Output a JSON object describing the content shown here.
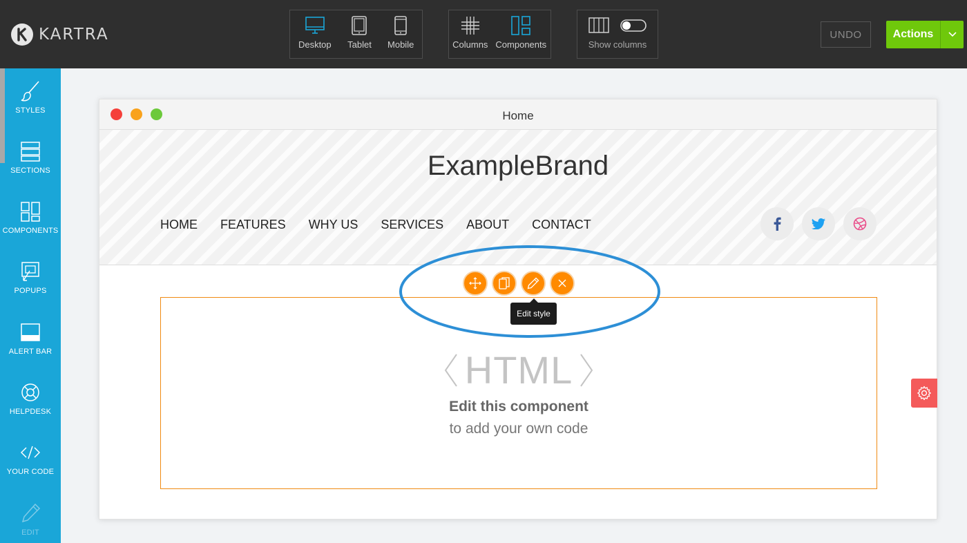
{
  "app": {
    "logo_text": "KARTRA"
  },
  "toolbar": {
    "devices": [
      {
        "label": "Desktop",
        "icon": "desktop-icon",
        "active": true
      },
      {
        "label": "Tablet",
        "icon": "tablet-icon",
        "active": false
      },
      {
        "label": "Mobile",
        "icon": "mobile-icon",
        "active": false
      }
    ],
    "layout": [
      {
        "label": "Columns",
        "icon": "grid-icon"
      },
      {
        "label": "Components",
        "icon": "components-icon"
      }
    ],
    "show_columns_label": "Show columns",
    "show_columns_on": false,
    "undo_label": "UNDO",
    "actions_label": "Actions"
  },
  "sidebar": {
    "items": [
      {
        "label": "STYLES",
        "icon": "brush-icon"
      },
      {
        "label": "SECTIONS",
        "icon": "sections-icon"
      },
      {
        "label": "COMPONENTS",
        "icon": "components-icon"
      },
      {
        "label": "POPUPS",
        "icon": "popup-icon"
      },
      {
        "label": "ALERT BAR",
        "icon": "alert-bar-icon"
      },
      {
        "label": "HELPDESK",
        "icon": "lifebuoy-icon"
      },
      {
        "label": "YOUR CODE",
        "icon": "code-icon"
      },
      {
        "label": "EDIT",
        "icon": "pencil-icon",
        "disabled": true
      }
    ]
  },
  "canvas": {
    "window_title": "Home",
    "brand": "ExampleBrand",
    "nav": [
      "HOME",
      "FEATURES",
      "WHY US",
      "SERVICES",
      "ABOUT",
      "CONTACT"
    ],
    "social": [
      "facebook-icon",
      "twitter-icon",
      "dribbble-icon"
    ],
    "component_tools": [
      "move-icon",
      "copy-icon",
      "pencil-icon",
      "close-icon"
    ],
    "tooltip": "Edit style",
    "html_component": {
      "word": "HTML",
      "title": "Edit this component",
      "subtitle": "to add your own code"
    }
  },
  "colors": {
    "topbar": "#2f2f2f",
    "sidebar": "#1aa6d8",
    "accent_orange": "#ff8a00",
    "actions_green": "#6fc80b",
    "highlight_ellipse": "#2d8fd6",
    "gear_tab": "#f45a5a"
  }
}
